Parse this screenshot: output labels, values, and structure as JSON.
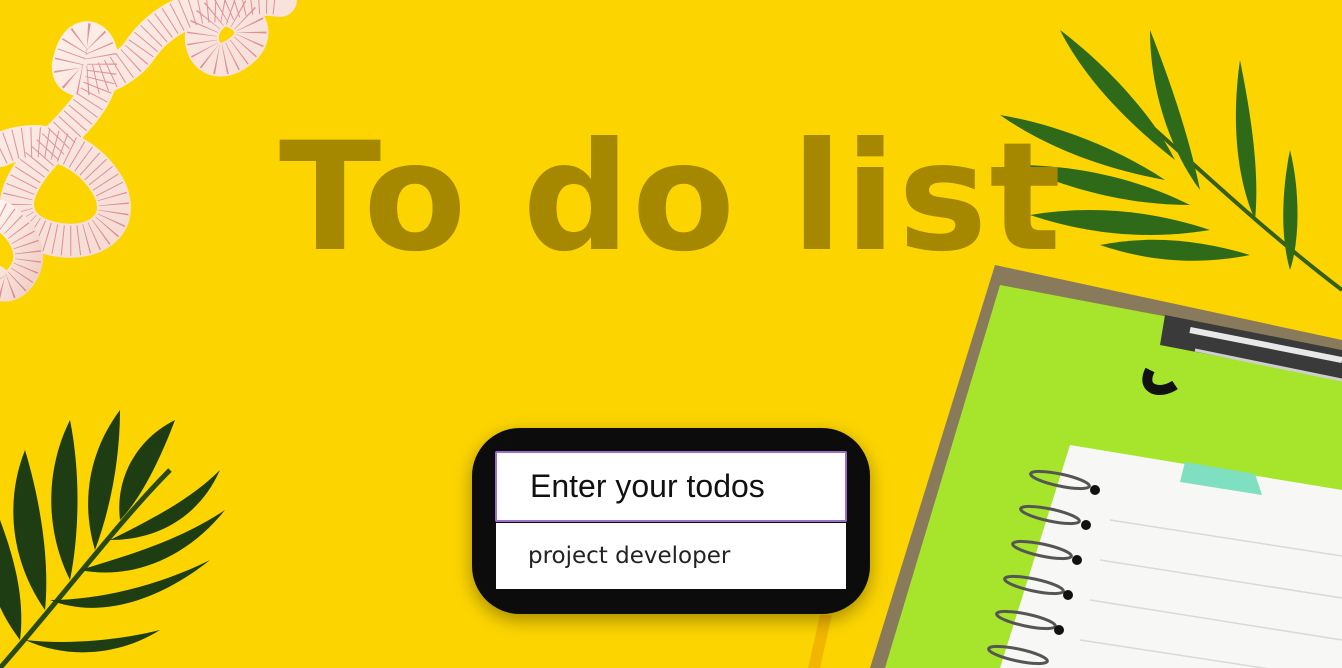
{
  "app": {
    "title": "To do list"
  },
  "todo_input": {
    "placeholder": "Enter your todos",
    "value": ""
  },
  "todos": [
    {
      "text": "project developer"
    }
  ],
  "background": {
    "color": "#fcd500",
    "objects": [
      "measuring-tape",
      "palm-leaf",
      "clipboard",
      "spiral-notebook"
    ]
  },
  "colors": {
    "title": "#a58700",
    "card": "#0c0c0c",
    "input_border": "#9b6fc8"
  }
}
